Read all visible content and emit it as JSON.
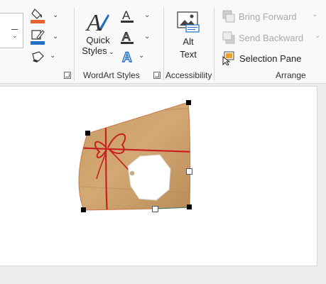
{
  "ribbon": {
    "wordart_group": {
      "quick_styles_line1": "Quick",
      "quick_styles_line2": "Styles",
      "label": "WordArt Styles"
    },
    "accessibility_group": {
      "alt_text_line1": "Alt",
      "alt_text_line2": "Text",
      "label": "Accessibility"
    },
    "arrange_group": {
      "bring_forward": "Bring Forward",
      "send_backward": "Send Backward",
      "selection_pane": "Selection Pane",
      "label": "Arrange"
    }
  },
  "colors": {
    "accent_orange": "#e8632b",
    "accent_blue": "#1f6fc5",
    "ribbon_bg": "#f9f9f9",
    "slide_bg": "#ffffff",
    "package_kraft": "#c89b65",
    "twine_red": "#c8201f"
  },
  "icons": [
    "dropdown-box-icon",
    "shape-fill-icon",
    "shape-outline-icon",
    "shape-effects-icon",
    "quick-styles-icon",
    "text-fill-icon",
    "text-outline-icon",
    "text-effects-icon",
    "alt-text-icon",
    "bring-forward-icon",
    "send-backward-icon",
    "selection-pane-icon"
  ]
}
